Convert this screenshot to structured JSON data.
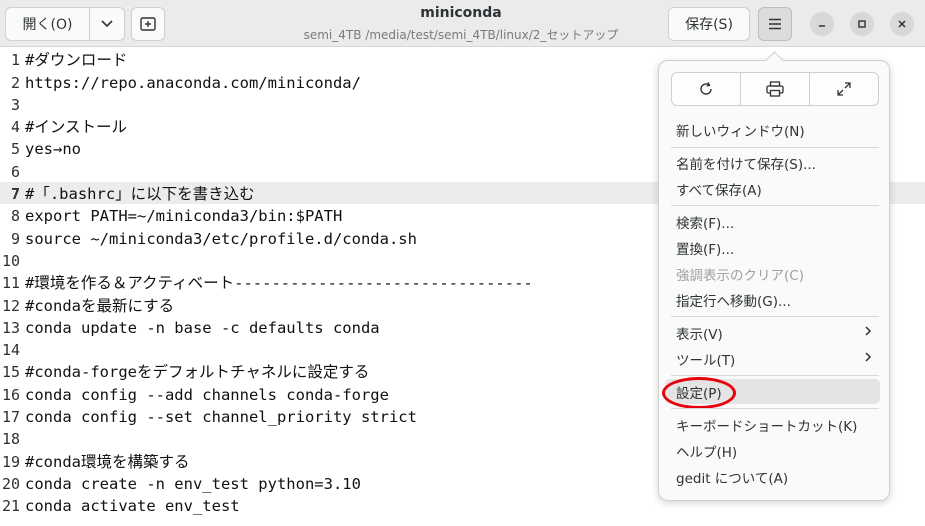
{
  "header": {
    "open_label": "開く(O)",
    "title": "miniconda",
    "subtitle": "semi_4TB /media/test/semi_4TB/linux/2_セットアップ",
    "save_label": "保存(S)"
  },
  "editor": {
    "current_line": 7,
    "lines": [
      {
        "n": "1",
        "text": "#ダウンロード"
      },
      {
        "n": "2",
        "text": "https://repo.anaconda.com/miniconda/"
      },
      {
        "n": "3",
        "text": ""
      },
      {
        "n": "4",
        "text": "#インストール"
      },
      {
        "n": "5",
        "text": "yes→no"
      },
      {
        "n": "6",
        "text": ""
      },
      {
        "n": "7",
        "text": "#「.bashrc」に以下を書き込む"
      },
      {
        "n": "8",
        "text": "export PATH=~/miniconda3/bin:$PATH"
      },
      {
        "n": "9",
        "text": "source ~/miniconda3/etc/profile.d/conda.sh"
      },
      {
        "n": "10",
        "text": ""
      },
      {
        "n": "11",
        "text": "#環境を作る＆アクティベート--------------------------------"
      },
      {
        "n": "12",
        "text": "#condaを最新にする"
      },
      {
        "n": "13",
        "text": "conda update -n base -c defaults conda"
      },
      {
        "n": "14",
        "text": ""
      },
      {
        "n": "15",
        "text": "#conda-forgeをデフォルトチャネルに設定する"
      },
      {
        "n": "16",
        "text": "conda config --add channels conda-forge"
      },
      {
        "n": "17",
        "text": "conda config --set channel_priority strict"
      },
      {
        "n": "18",
        "text": ""
      },
      {
        "n": "19",
        "text": "#conda環境を構築する"
      },
      {
        "n": "20",
        "text": "conda create -n env_test python=3.10"
      },
      {
        "n": "21",
        "text": "conda activate env_test"
      }
    ]
  },
  "menu": {
    "new_window": "新しいウィンドウ(N)",
    "save_as": "名前を付けて保存(S)...",
    "save_all": "すべて保存(A)",
    "find": "検索(F)...",
    "replace": "置換(F)...",
    "clear_highlight": "強調表示のクリア(C)",
    "goto_line": "指定行へ移動(G)...",
    "view": "表示(V)",
    "tools": "ツール(T)",
    "preferences": "設定(P)",
    "shortcuts": "キーボードショートカット(K)",
    "help": "ヘルプ(H)",
    "about": "gedit について(A)"
  },
  "colors": {
    "highlight_ring": "#e8000b",
    "current_line_bg": "#ececec"
  }
}
